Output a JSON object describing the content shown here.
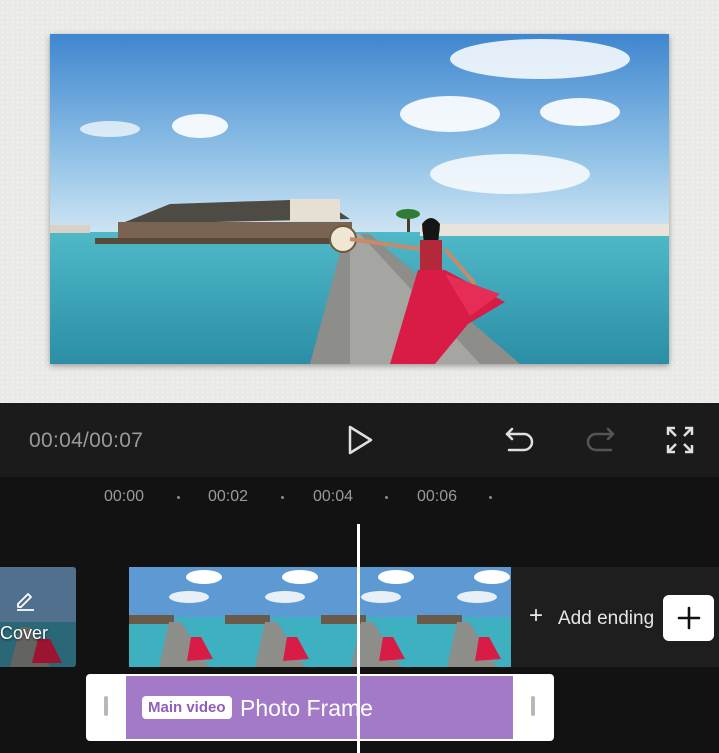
{
  "player": {
    "timecode": "00:04/00:07",
    "play_icon": "play-icon",
    "undo_icon": "undo-icon",
    "redo_icon": "redo-icon",
    "fullscreen_icon": "fullscreen-icon"
  },
  "timeline": {
    "ruler": [
      "00:00",
      "00:02",
      "00:04",
      "00:06"
    ],
    "cover_label": "Cover",
    "cover_icon": "pencil-icon",
    "add_ending_label": "Add ending",
    "add_icon": "plus-icon",
    "audio_badge": "Main video",
    "audio_title": "Photo Frame"
  },
  "colors": {
    "clip_purple": "#a37ac7",
    "background": "#121212",
    "controls_bg": "#1b1b1b"
  }
}
